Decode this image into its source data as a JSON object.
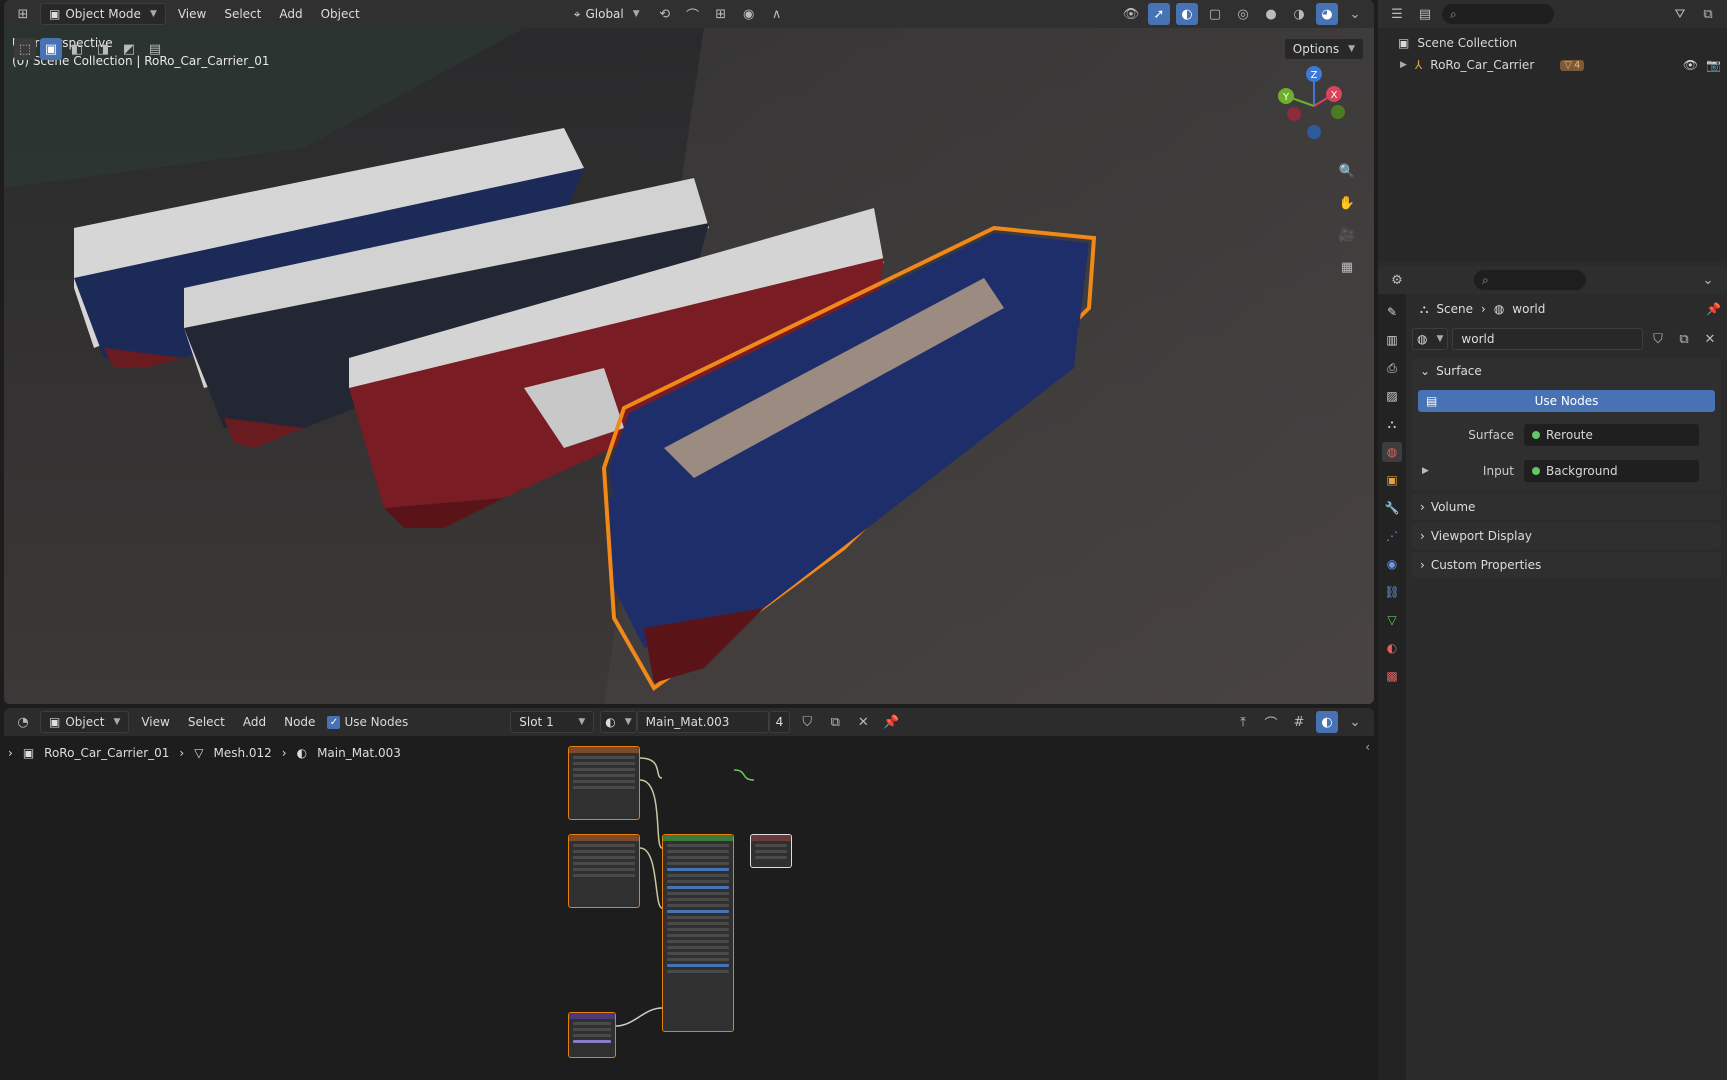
{
  "viewport": {
    "mode": "Object Mode",
    "menus": [
      "View",
      "Select",
      "Add",
      "Object"
    ],
    "orientation": "Global",
    "options": "Options",
    "overlay_line1": "User Perspective",
    "overlay_line2": "(0) Scene Collection | RoRo_Car_Carrier_01",
    "gizmo": {
      "z": "Z",
      "y": "Y",
      "x": "X"
    },
    "hull_colors": [
      "#1c2a58",
      "#222733",
      "#7a1c24",
      "#1d2e6b"
    ],
    "selection_color": "#f0891a"
  },
  "node_editor": {
    "mode": "Object",
    "menus": [
      "View",
      "Select",
      "Add",
      "Node"
    ],
    "use_nodes_label": "Use Nodes",
    "use_nodes_checked": true,
    "slot": "Slot 1",
    "material": "Main_Mat.003",
    "users": "4",
    "breadcrumb": [
      "RoRo_Car_Carrier_01",
      "Mesh.012",
      "Main_Mat.003"
    ]
  },
  "outliner": {
    "search_placeholder": "",
    "root": "Scene Collection",
    "item": "RoRo_Car_Carrier",
    "item_badge": "4"
  },
  "properties": {
    "breadcrumb": [
      "Scene",
      "world"
    ],
    "world_name": "world",
    "sections": {
      "surface": "Surface",
      "use_nodes": "Use Nodes",
      "surface_label": "Surface",
      "surface_value": "Reroute",
      "input_label": "Input",
      "input_value": "Background",
      "volume": "Volume",
      "viewport_display": "Viewport Display",
      "custom_properties": "Custom Properties"
    }
  }
}
